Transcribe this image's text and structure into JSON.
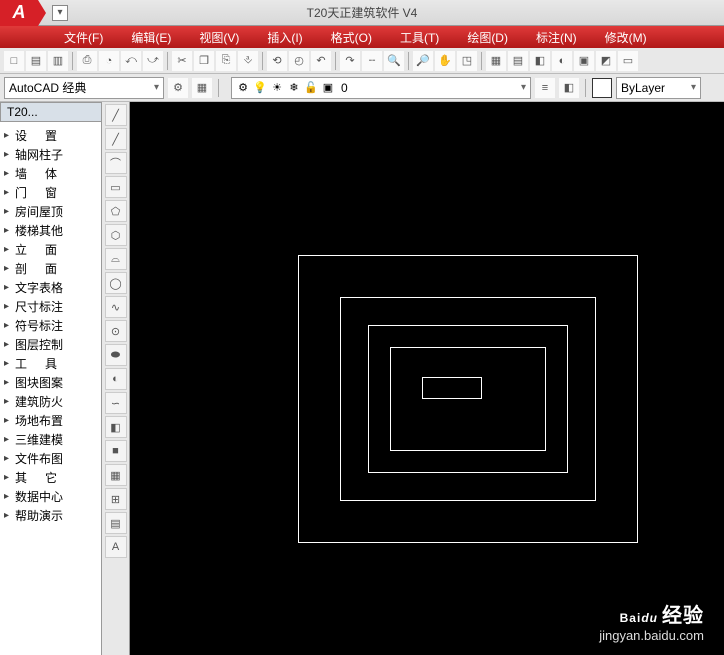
{
  "title": {
    "center": "T20天正建筑软件 V4",
    "logo": "A"
  },
  "menus": [
    "文件(F)",
    "编辑(E)",
    "视图(V)",
    "插入(I)",
    "格式(O)",
    "工具(T)",
    "绘图(D)",
    "标注(N)",
    "修改(M)"
  ],
  "workspace": {
    "label": "AutoCAD 经典"
  },
  "layer": {
    "name": "0"
  },
  "bylayer": {
    "label": "ByLayer"
  },
  "panel": {
    "title": "T20..."
  },
  "tree": [
    {
      "label": "设置",
      "cls": "spread2"
    },
    {
      "label": "轴网柱子"
    },
    {
      "label": "墙体",
      "cls": "spread2"
    },
    {
      "label": "门窗",
      "cls": "spread2"
    },
    {
      "label": "房间屋顶"
    },
    {
      "label": "楼梯其他"
    },
    {
      "label": "立面",
      "cls": "spread2"
    },
    {
      "label": "剖面",
      "cls": "spread2"
    },
    {
      "label": "文字表格"
    },
    {
      "label": "尺寸标注"
    },
    {
      "label": "符号标注"
    },
    {
      "label": "图层控制"
    },
    {
      "label": "工具",
      "cls": "spread2"
    },
    {
      "label": "图块图案"
    },
    {
      "label": "建筑防火"
    },
    {
      "label": "场地布置"
    },
    {
      "label": "三维建模"
    },
    {
      "label": "文件布图"
    },
    {
      "label": "其它",
      "cls": "spread2"
    },
    {
      "label": "数据中心"
    },
    {
      "label": "帮助演示"
    }
  ],
  "toolbar_row1": [
    "□",
    "▤",
    "▥",
    "⎙",
    "◔",
    "⤺",
    "⤻",
    "✂",
    "❐",
    "⎘",
    "⎀",
    "⟲",
    "◴",
    "↶",
    "↷",
    "╌",
    "🔍",
    "🔎",
    "✋",
    "◳",
    "▦",
    "▤",
    "◧",
    "◐",
    "▣",
    "◩",
    "▭"
  ],
  "draw_tools": [
    "╱",
    "╱",
    "⌒",
    "▭",
    "⬠",
    "⬡",
    "⌓",
    "◯",
    "∿",
    "⊙",
    "⬬",
    "◐",
    "∽",
    "◧",
    "■",
    "▦",
    "⊞",
    "▤",
    "A"
  ],
  "layer_icons": [
    "⚙",
    "💡",
    "☀",
    "❄",
    "🔓",
    "▣"
  ],
  "watermark": {
    "brand_prefix": "Bai",
    "brand_du": "du",
    "brand_suffix": "经验",
    "url": "jingyan.baidu.com"
  }
}
